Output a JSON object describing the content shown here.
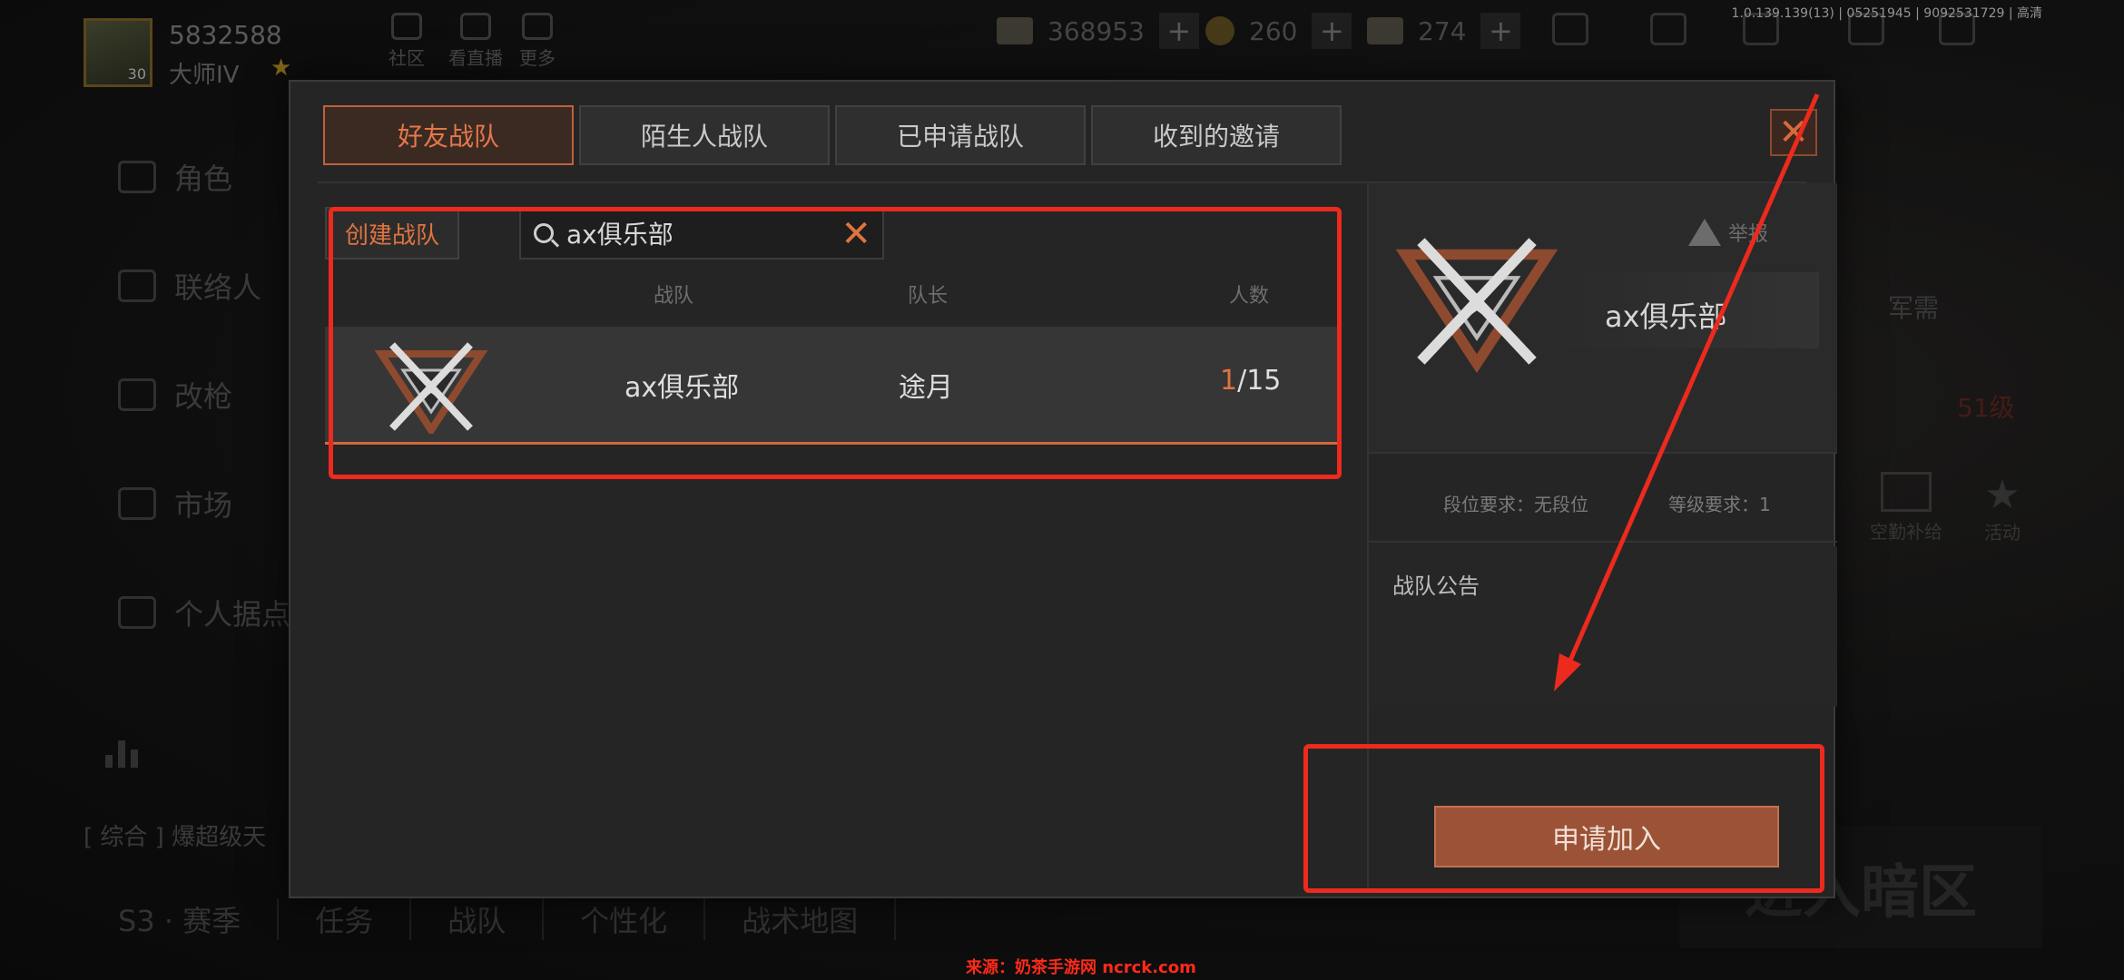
{
  "version": "1.0.139.139(13) | 05251945 | 9092531729 | 高清",
  "player": {
    "id": "5832588",
    "rank": "大师IV",
    "level": "30"
  },
  "top_nav": [
    {
      "label": "社区",
      "icon": "weibo-icon"
    },
    {
      "label": "看直播",
      "icon": "tv-icon"
    },
    {
      "label": "更多",
      "icon": "grid-icon"
    }
  ],
  "currency": {
    "cash": "368953",
    "coins": "260",
    "tickets": "274"
  },
  "left_menu": [
    "角色",
    "联络人",
    "改枪",
    "市场",
    "个人据点"
  ],
  "news_text": "[ 综合 ]   爆超级天",
  "bottom_tabs": [
    "S3 · 赛季",
    "任务",
    "战队",
    "个性化",
    "战术地图"
  ],
  "right_bg": {
    "junxu": "军需",
    "level": "51级",
    "supply": "空勤补给",
    "event": "活动",
    "darkzone": "进入暗区"
  },
  "modal": {
    "tabs": [
      "好友战队",
      "陌生人战队",
      "已申请战队",
      "收到的邀请"
    ],
    "active_tab": "好友战队",
    "create_label": "创建战队",
    "search_value": "ax俱乐部",
    "columns": {
      "team": "战队",
      "leader": "队长",
      "count": "人数"
    },
    "rows": [
      {
        "name": "ax俱乐部",
        "leader": "途月",
        "current": "1",
        "max": "/15"
      }
    ],
    "detail": {
      "report": "举报",
      "name": "ax俱乐部",
      "rank_req": "段位要求：无段位",
      "level_req": "等级要求：1",
      "notice_title": "战队公告",
      "apply_label": "申请加入"
    }
  },
  "watermark": "来源：奶茶手游网 ncrck.com",
  "colors": {
    "accent": "#e0733f",
    "annotation": "#ec2a1d",
    "apply": "#9b5236"
  }
}
